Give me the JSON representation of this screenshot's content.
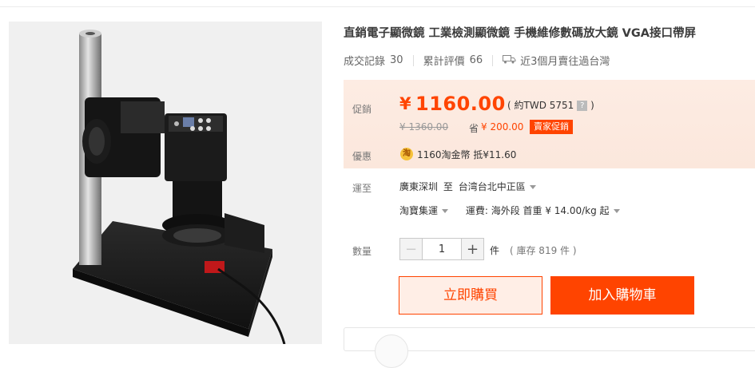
{
  "product": {
    "title": "直銷電子顯微鏡 工業檢測顯微鏡 手機維修數碼放大鏡 VGA接口帶屏",
    "stats": {
      "deals_label": "成交記錄",
      "deals_value": "30",
      "reviews_label": "累計評價",
      "reviews_value": "66",
      "shipping_note": "近3個月賣往過台灣"
    }
  },
  "price": {
    "promo_label": "促銷",
    "currency_symbol": "¥",
    "current": "1160.00",
    "twd": "( 約TWD 5751",
    "twd_close": ")",
    "help_mark": "?",
    "original": "¥ 1360.00",
    "save_label": "省",
    "save_value": "¥ 200.00",
    "badge": "賣家促銷",
    "benefit_label": "優惠",
    "coin_glyph": "淘",
    "coin_text": "1160淘金幣 抵¥11.60"
  },
  "shipping": {
    "label": "運至",
    "from": "廣東深圳",
    "to_label": "至",
    "to": "台湾台北中正區",
    "method": "淘寶集運",
    "fee": "運費: 海外段 首重 ¥ 14.00/kg 起"
  },
  "quantity": {
    "label": "數量",
    "minus": "−",
    "plus": "+",
    "value": "1",
    "unit": "件",
    "stock": "( 庫存 819 件 )"
  },
  "actions": {
    "buy_now": "立即購買",
    "add_to_cart": "加入購物車"
  },
  "colors": {
    "accent": "#ff4400",
    "price_bg": "#fdece3"
  }
}
